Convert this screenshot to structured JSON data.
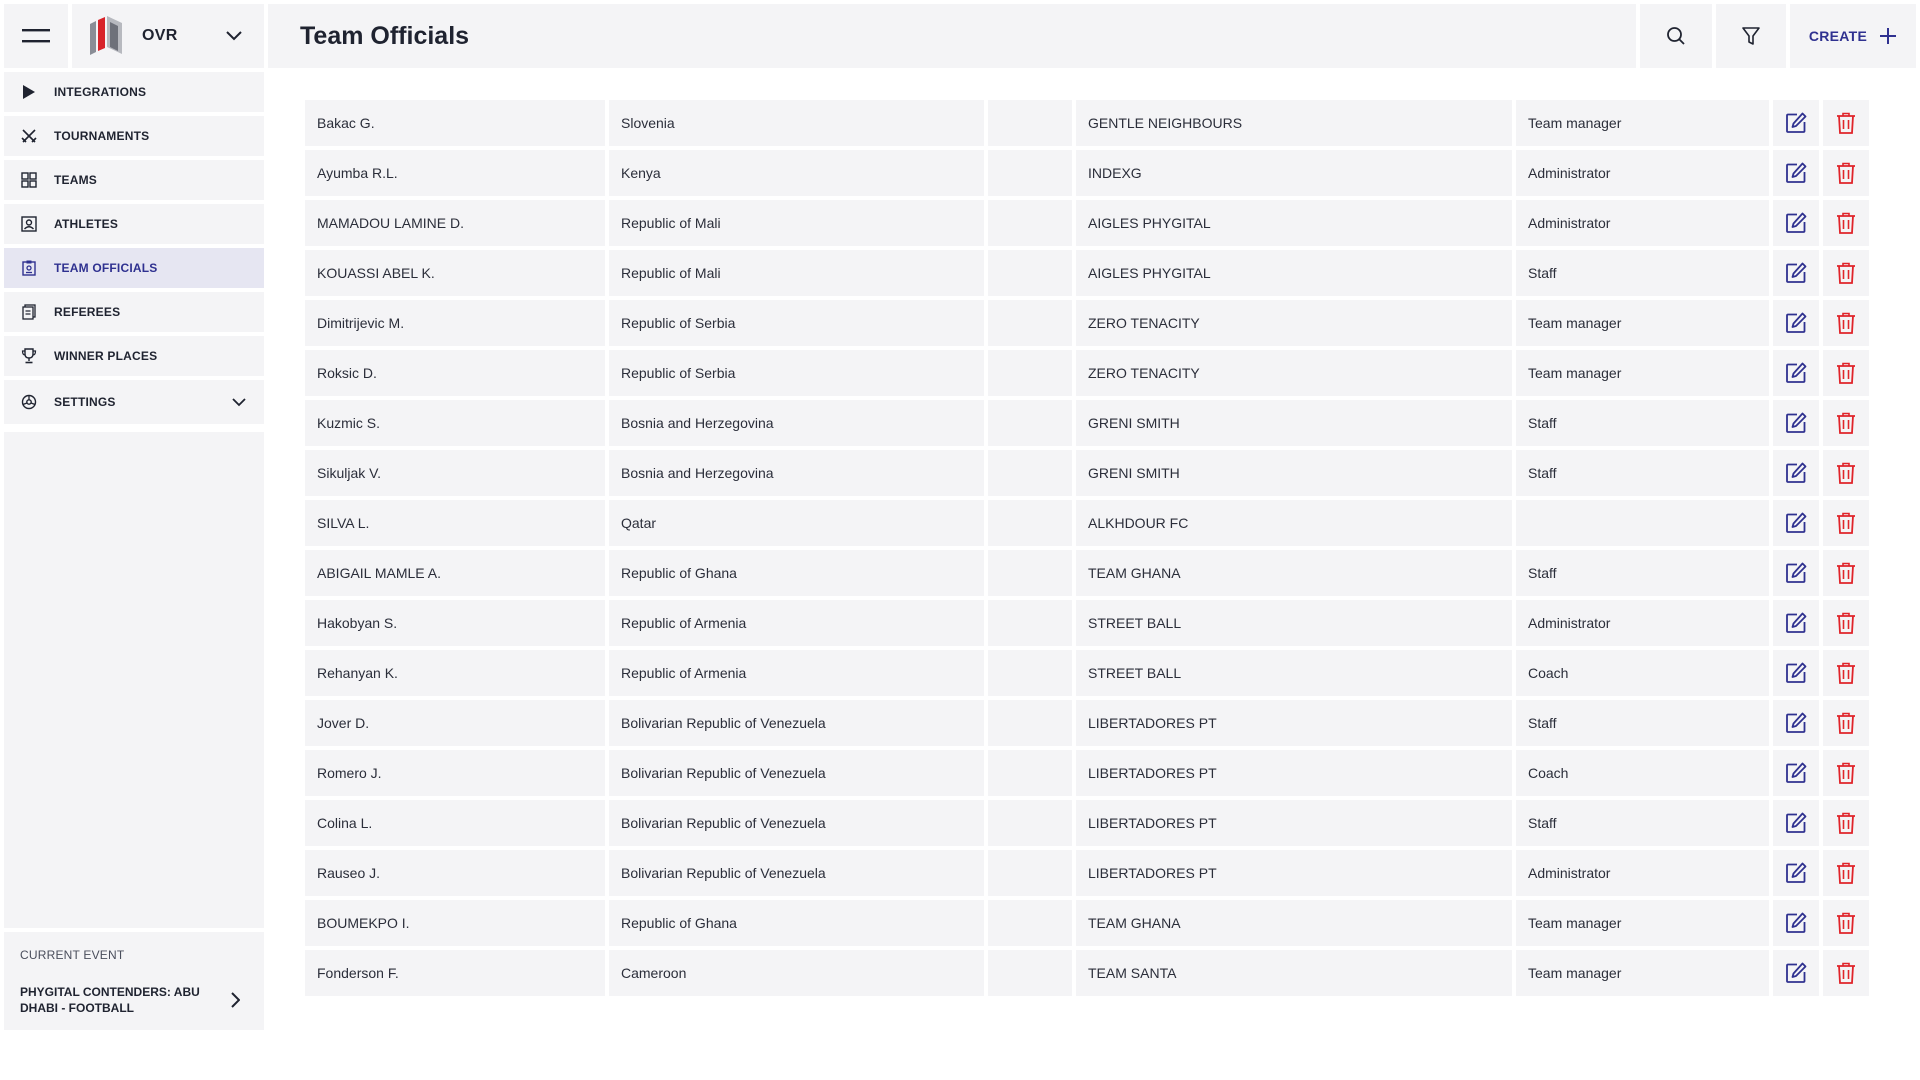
{
  "app": {
    "name": "OVR"
  },
  "page": {
    "title": "Team Officials"
  },
  "toolbar": {
    "create_label": "CREATE"
  },
  "sidebar": {
    "items": [
      {
        "label": "INTEGRATIONS",
        "icon": "play-icon"
      },
      {
        "label": "TOURNAMENTS",
        "icon": "tournament-icon"
      },
      {
        "label": "TEAMS",
        "icon": "teams-icon"
      },
      {
        "label": "ATHLETES",
        "icon": "athlete-icon"
      },
      {
        "label": "TEAM OFFICIALS",
        "icon": "badge-icon",
        "active": true
      },
      {
        "label": "REFEREES",
        "icon": "referee-icon"
      },
      {
        "label": "WINNER PLACES",
        "icon": "trophy-icon"
      },
      {
        "label": "SETTINGS",
        "icon": "settings-icon"
      }
    ],
    "current_event_label": "CURRENT EVENT",
    "current_event_name": "PHYGITAL CONTENDERS: ABU DHABI - FOOTBALL"
  },
  "colors": {
    "accent": "#2f3190",
    "delete": "#e0242a",
    "panel": "#f4f4f6"
  },
  "officials": [
    {
      "name": "Bakac G.",
      "country": "Slovenia",
      "team": "GENTLE NEIGHBOURS",
      "role": "Team manager"
    },
    {
      "name": "Ayumba R.L.",
      "country": "Kenya",
      "team": "INDEXG",
      "role": "Administrator"
    },
    {
      "name": "MAMADOU LAMINE D.",
      "country": "Republic of Mali",
      "team": "AIGLES PHYGITAL",
      "role": "Administrator"
    },
    {
      "name": "KOUASSI ABEL K.",
      "country": "Republic of Mali",
      "team": "AIGLES PHYGITAL",
      "role": "Staff"
    },
    {
      "name": "Dimitrijevic M.",
      "country": "Republic of Serbia",
      "team": "ZERO TENACITY",
      "role": "Team manager"
    },
    {
      "name": "Roksic D.",
      "country": "Republic of Serbia",
      "team": "ZERO TENACITY",
      "role": "Team manager"
    },
    {
      "name": "Kuzmic S.",
      "country": "Bosnia and Herzegovina",
      "team": "GRENI SMITH",
      "role": "Staff"
    },
    {
      "name": "Sikuljak V.",
      "country": "Bosnia and Herzegovina",
      "team": "GRENI SMITH",
      "role": "Staff"
    },
    {
      "name": "SILVA L.",
      "country": "Qatar",
      "team": "ALKHDOUR FC",
      "role": ""
    },
    {
      "name": "ABIGAIL MAMLE A.",
      "country": "Republic of Ghana",
      "team": "TEAM GHANA",
      "role": "Staff"
    },
    {
      "name": "Hakobyan S.",
      "country": "Republic of Armenia",
      "team": "STREET BALL",
      "role": "Administrator"
    },
    {
      "name": "Rehanyan K.",
      "country": "Republic of Armenia",
      "team": "STREET BALL",
      "role": "Coach"
    },
    {
      "name": "Jover D.",
      "country": "Bolivarian Republic of Venezuela",
      "team": "LIBERTADORES PT",
      "role": "Staff"
    },
    {
      "name": "Romero J.",
      "country": "Bolivarian Republic of Venezuela",
      "team": "LIBERTADORES PT",
      "role": "Coach"
    },
    {
      "name": "Colina L.",
      "country": "Bolivarian Republic of Venezuela",
      "team": "LIBERTADORES PT",
      "role": "Staff"
    },
    {
      "name": "Rauseo J.",
      "country": "Bolivarian Republic of Venezuela",
      "team": "LIBERTADORES PT",
      "role": "Administrator"
    },
    {
      "name": "BOUMEKPO I.",
      "country": "Republic of Ghana",
      "team": "TEAM GHANA",
      "role": "Team manager"
    },
    {
      "name": "Fonderson F.",
      "country": "Cameroon",
      "team": "TEAM SANTA",
      "role": "Team manager"
    }
  ]
}
